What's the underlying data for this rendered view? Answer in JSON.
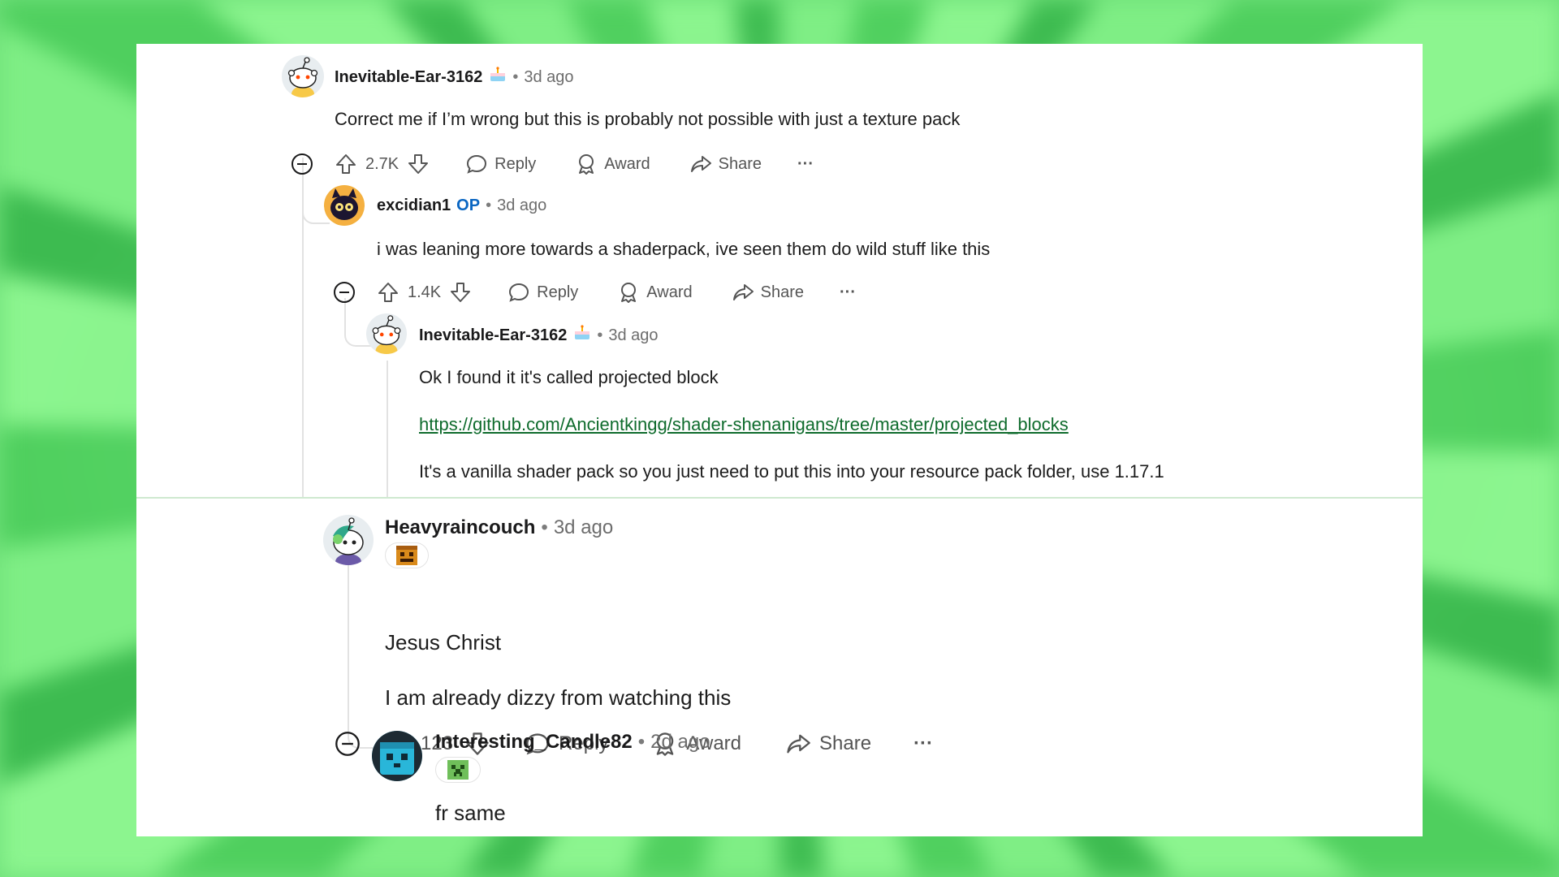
{
  "comments": [
    {
      "author": "Inevitable-Ear-3162",
      "time": "3d ago",
      "text": "Correct me if I’m wrong but this is probably not possible with just a texture pack",
      "votes": "2.7K"
    },
    {
      "author": "excidian1",
      "badge": "OP",
      "time": "3d ago",
      "text": "i was leaning more towards a shaderpack, ive seen them do wild stuff like this",
      "votes": "1.4K"
    },
    {
      "author": "Inevitable-Ear-3162",
      "time": "3d ago",
      "text1": "Ok I found it it's called projected block",
      "link": "https://github.com/Ancientkingg/shader-shenanigans/tree/master/projected_blocks",
      "text2": "It's a vanilla shader pack so you just need to put this into your resource pack folder, use 1.17.1"
    },
    {
      "author": "Heavyraincouch",
      "time": "3d ago",
      "text1": "Jesus Christ",
      "text2": "I am already dizzy from watching this",
      "votes": "123"
    },
    {
      "author": "Interesting_Candle82",
      "time": "2d ago",
      "text": "fr same"
    }
  ],
  "actions": {
    "reply": "Reply",
    "award": "Award",
    "share": "Share",
    "more": "···"
  },
  "separator": "•",
  "colors": {
    "background_green": "#6fe07a",
    "op_blue": "#0a66c2",
    "link_green": "#0e6b2c"
  },
  "icons": [
    "collapse-icon",
    "upvote-icon",
    "downvote-icon",
    "reply-icon",
    "award-icon",
    "share-icon",
    "more-icon",
    "cake-icon"
  ]
}
